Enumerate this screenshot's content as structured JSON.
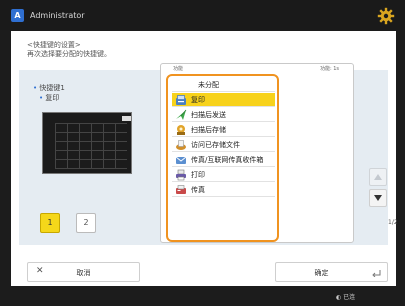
{
  "header": {
    "user_icon_label": "A",
    "user_name": "Administrator",
    "settings_icon": "gear-icon"
  },
  "instructions": {
    "line1": "<快捷键的设置>",
    "line2": "再次选择要分配的快捷键。"
  },
  "tree": {
    "root": "快捷键1",
    "child": "复印"
  },
  "preview": {
    "label": "1"
  },
  "pages": [
    {
      "label": "1",
      "active": true
    },
    {
      "label": "2",
      "active": false
    }
  ],
  "list_header": {
    "left": "功能",
    "right": "功能: 1s"
  },
  "options": [
    {
      "label": "未分配",
      "icon": "none",
      "selected": false
    },
    {
      "label": "复印",
      "icon": "copy-icon",
      "selected": true
    },
    {
      "label": "扫描后发送",
      "icon": "scan-send-icon",
      "selected": false
    },
    {
      "label": "扫描后存储",
      "icon": "scan-store-icon",
      "selected": false
    },
    {
      "label": "访问已存储文件",
      "icon": "stored-files-icon",
      "selected": false
    },
    {
      "label": "传真/互联网传真收件箱",
      "icon": "fax-inbox-icon",
      "selected": false
    },
    {
      "label": "打印",
      "icon": "print-icon",
      "selected": false
    },
    {
      "label": "传真",
      "icon": "fax-icon",
      "selected": false
    }
  ],
  "pagination": {
    "indicator": "1/2"
  },
  "buttons": {
    "cancel_label": "取消",
    "ok_label": "确定"
  },
  "footer": {
    "status_text": "已连"
  },
  "colors": {
    "accent_selected": "#f7d21b",
    "dropdown_border": "#f09320",
    "header_bg": "#1a1a1a"
  }
}
